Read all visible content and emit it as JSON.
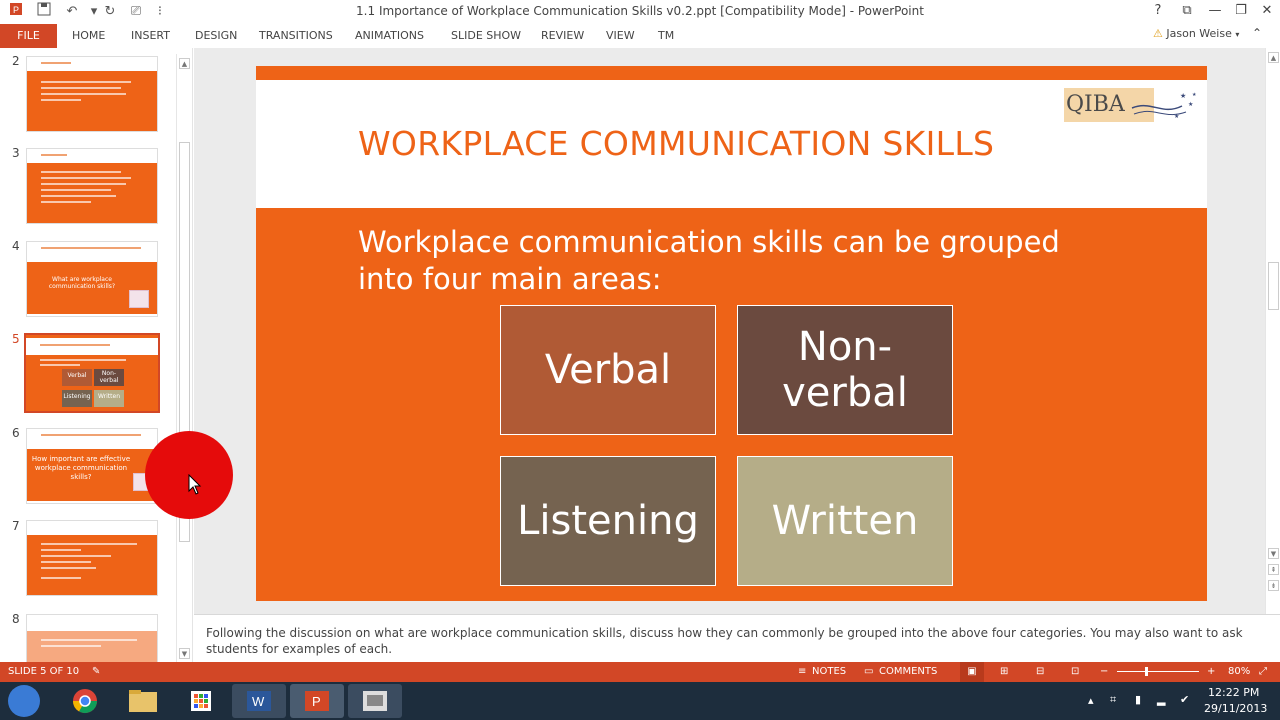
{
  "window": {
    "title": "1.1 Importance of Workplace Communication Skills v0.2.ppt [Compatibility Mode] - PowerPoint"
  },
  "ribbon": {
    "file_label": "FILE",
    "tabs": [
      "HOME",
      "INSERT",
      "DESIGN",
      "TRANSITIONS",
      "ANIMATIONS",
      "SLIDE SHOW",
      "REVIEW",
      "VIEW",
      "TM"
    ],
    "user_name": "Jason Weise"
  },
  "thumbnails": {
    "numbers": [
      "2",
      "3",
      "4",
      "5",
      "6",
      "7",
      "8"
    ],
    "slide4_title": "What are workplace communication skills?",
    "slide5_boxes": [
      "Verbal",
      "Non-verbal",
      "Listening",
      "Written"
    ],
    "slide6_title": "How important are effective workplace communication skills?"
  },
  "slide": {
    "title": "WORKPLACE COMMUNICATION SKILLS",
    "body": "Workplace communication skills can be grouped into four main areas:",
    "logo_text": "QIBA",
    "boxes": [
      {
        "label": "Verbal",
        "color": "#b05a35"
      },
      {
        "label": "Non-verbal",
        "color": "#6b4a3f"
      },
      {
        "label": "Listening",
        "color": "#756350"
      },
      {
        "label": "Written",
        "color": "#b5ad88"
      }
    ]
  },
  "notes": {
    "text": "Following the discussion on what are workplace communication skills, discuss how they can commonly be grouped into the above four categories.   You may also want to ask students for examples of each."
  },
  "statusbar": {
    "slide_indicator": "SLIDE 5 OF 10",
    "notes_label": "NOTES",
    "comments_label": "COMMENTS",
    "zoom": "80%"
  },
  "taskbar": {
    "time": "12:22 PM",
    "date": "29/11/2013"
  },
  "colors": {
    "accent": "#d24726",
    "slide_orange": "#ee6317"
  }
}
